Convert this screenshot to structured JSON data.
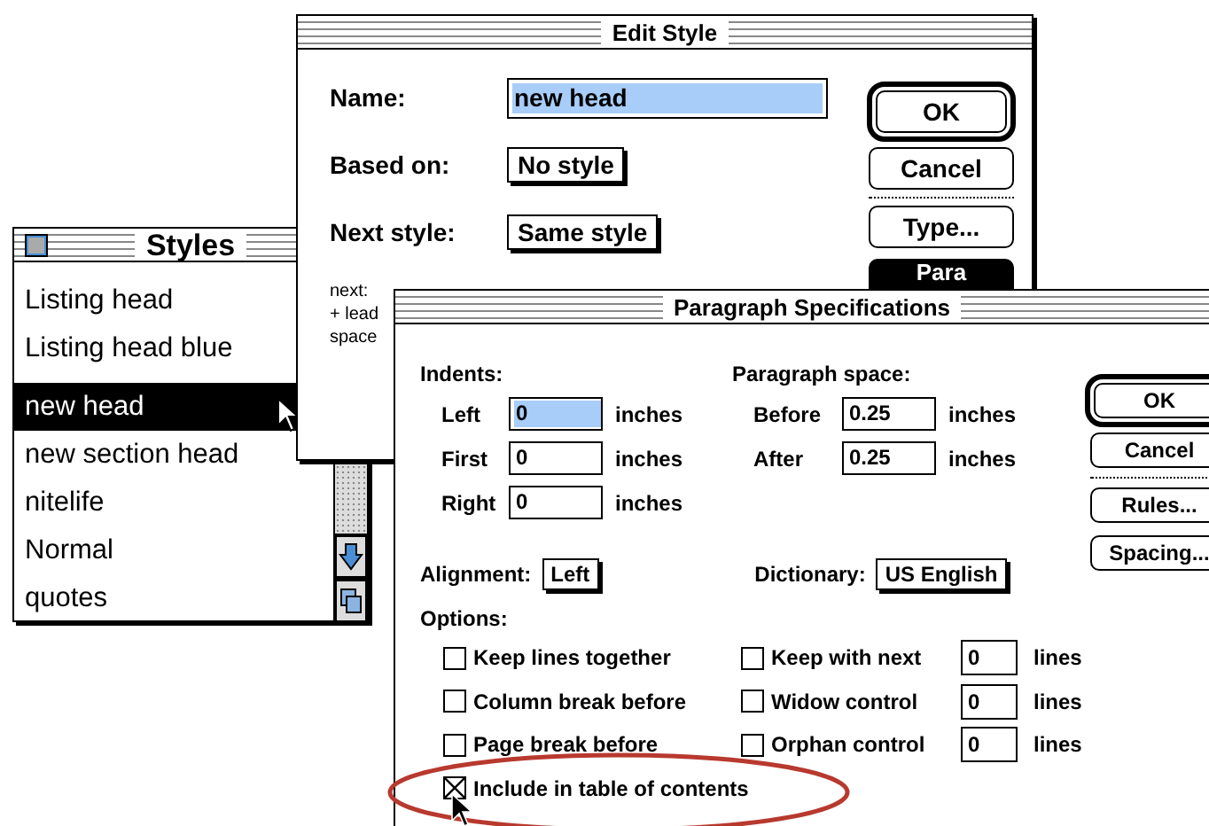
{
  "styles_window": {
    "title": "Styles",
    "items": [
      {
        "label": "Listing head",
        "selected": false
      },
      {
        "label": "Listing head blue",
        "selected": false
      },
      {
        "label": "new head",
        "selected": true
      },
      {
        "label": "new section head",
        "selected": false
      },
      {
        "label": "nitelife",
        "selected": false
      },
      {
        "label": "Normal",
        "selected": false
      },
      {
        "label": "quotes",
        "selected": false
      }
    ]
  },
  "edit_style": {
    "title": "Edit Style",
    "fields": [
      {
        "label": "Name:",
        "value": "new head",
        "kind": "input",
        "highlighted": true
      },
      {
        "label": "Based on:",
        "value": "No style",
        "kind": "popup",
        "highlighted": false
      },
      {
        "label": "Next style:",
        "value": "Same style",
        "kind": "popup",
        "highlighted": false
      }
    ],
    "description_lines": [
      "next:",
      "+ lead",
      "space"
    ],
    "buttons": [
      {
        "label": "OK",
        "kind": "default"
      },
      {
        "label": "Cancel",
        "kind": "normal"
      },
      {
        "label": "Type...",
        "kind": "normal"
      },
      {
        "label": "Para",
        "kind": "pressed"
      }
    ]
  },
  "paragraph_specs": {
    "title": "Paragraph Specifications",
    "indents": {
      "label": "Indents:",
      "rows": [
        {
          "label": "Left",
          "value": "0",
          "unit": "inches",
          "highlighted": true
        },
        {
          "label": "First",
          "value": "0",
          "unit": "inches",
          "highlighted": false
        },
        {
          "label": "Right",
          "value": "0",
          "unit": "inches",
          "highlighted": false
        }
      ]
    },
    "paragraph_space": {
      "label": "Paragraph space:",
      "rows": [
        {
          "label": "Before",
          "value": "0.25",
          "unit": "inches",
          "highlighted": false
        },
        {
          "label": "After",
          "value": "0.25",
          "unit": "inches",
          "highlighted": false
        }
      ]
    },
    "alignment": {
      "label": "Alignment:",
      "value": "Left"
    },
    "dictionary": {
      "label": "Dictionary:",
      "value": "US English"
    },
    "options": {
      "label": "Options:",
      "checkboxes": [
        {
          "label": "Keep lines together",
          "checked": false
        },
        {
          "label": "Column break before",
          "checked": false
        },
        {
          "label": "Page break before",
          "checked": false
        },
        {
          "label": "Include in table of contents",
          "checked": true
        }
      ],
      "line_controls": [
        {
          "label": "Keep with next",
          "checked": false,
          "value": "0",
          "unit": "lines"
        },
        {
          "label": "Widow control",
          "checked": false,
          "value": "0",
          "unit": "lines"
        },
        {
          "label": "Orphan control",
          "checked": false,
          "value": "0",
          "unit": "lines"
        }
      ]
    },
    "buttons": [
      {
        "label": "OK",
        "kind": "default"
      },
      {
        "label": "Cancel",
        "kind": "normal"
      },
      {
        "label": "Rules...",
        "kind": "normal"
      },
      {
        "label": "Spacing...",
        "kind": "normal"
      }
    ]
  }
}
